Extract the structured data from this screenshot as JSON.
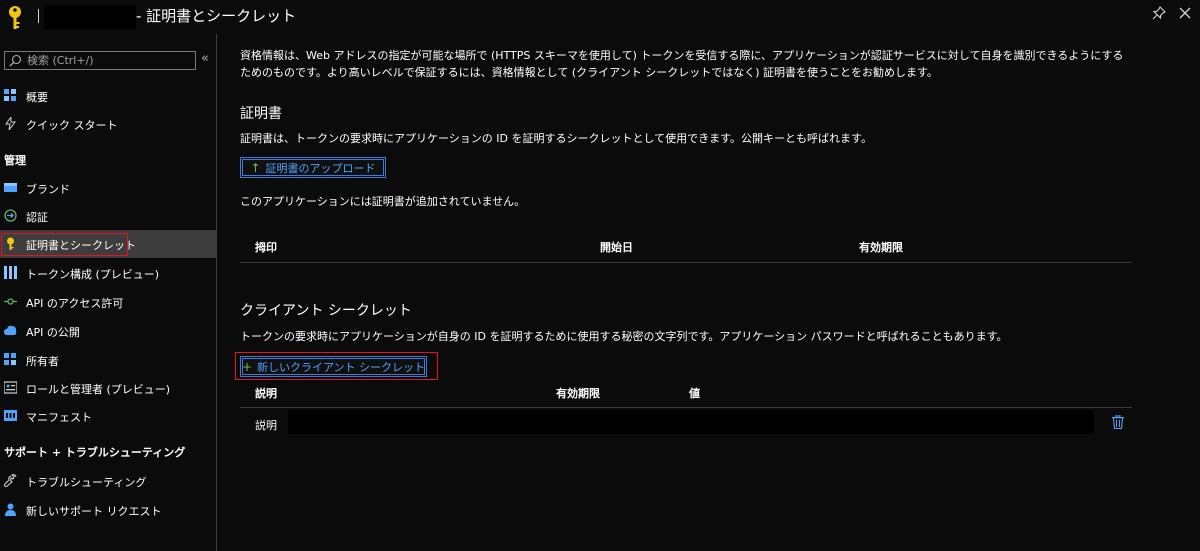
{
  "window": {
    "title": "- 証明書とシークレット"
  },
  "sidebar": {
    "search_placeholder": "検索 (Ctrl+/)",
    "collapse": "«",
    "items_top": [
      {
        "label": "概要",
        "icon": "overview-icon"
      },
      {
        "label": "クイック スタート",
        "icon": "quickstart-icon"
      }
    ],
    "section_manage": "管理",
    "items_manage": [
      {
        "label": "ブランド",
        "icon": "branding-icon"
      },
      {
        "label": "認証",
        "icon": "authentication-icon"
      },
      {
        "label": "証明書とシークレット",
        "icon": "key-icon",
        "active": true
      },
      {
        "label": "トークン構成 (プレビュー)",
        "icon": "token-config-icon"
      },
      {
        "label": "API のアクセス許可",
        "icon": "api-permissions-icon"
      },
      {
        "label": "API の公開",
        "icon": "expose-api-icon"
      },
      {
        "label": "所有者",
        "icon": "owners-icon"
      },
      {
        "label": "ロールと管理者 (プレビュー)",
        "icon": "roles-icon"
      },
      {
        "label": "マニフェスト",
        "icon": "manifest-icon"
      }
    ],
    "section_support": "サポート + トラブルシューティング",
    "items_support": [
      {
        "label": "トラブルシューティング",
        "icon": "wrench-icon"
      },
      {
        "label": "新しいサポート リクエスト",
        "icon": "support-person-icon"
      }
    ]
  },
  "main": {
    "intro": "資格情報は、Web アドレスの指定が可能な場所で (HTTPS スキーマを使用して) トークンを受信する際に、アプリケーションが認証サービスに対して自身を識別できるようにするためのものです。より高いレベルで保証するには、資格情報として (クライアント シークレットではなく) 証明書を使うことをお勧めします。",
    "certificates": {
      "title": "証明書",
      "description": "証明書は、トークンの要求時にアプリケーションの ID を証明するシークレットとして使用できます。公開キーとも呼ばれます。",
      "upload_button": "証明書のアップロード",
      "empty_message": "このアプリケーションには証明書が追加されていません。",
      "columns": [
        "拇印",
        "開始日",
        "有効期限"
      ]
    },
    "client_secrets": {
      "title": "クライアント シークレット",
      "description": "トークンの要求時にアプリケーションが自身の ID を証明するために使用する秘密の文字列です。アプリケーション パスワードと呼ばれることもあります。",
      "new_button": "新しいクライアント シークレット",
      "columns": [
        "説明",
        "有効期限",
        "値"
      ],
      "rows": [
        {
          "description": "説明"
        }
      ]
    }
  },
  "colors": {
    "background": "#0b0b0b",
    "accent": "#4fa3ff",
    "highlight_red": "#e81123",
    "active_nav": "#3d3d3d"
  }
}
